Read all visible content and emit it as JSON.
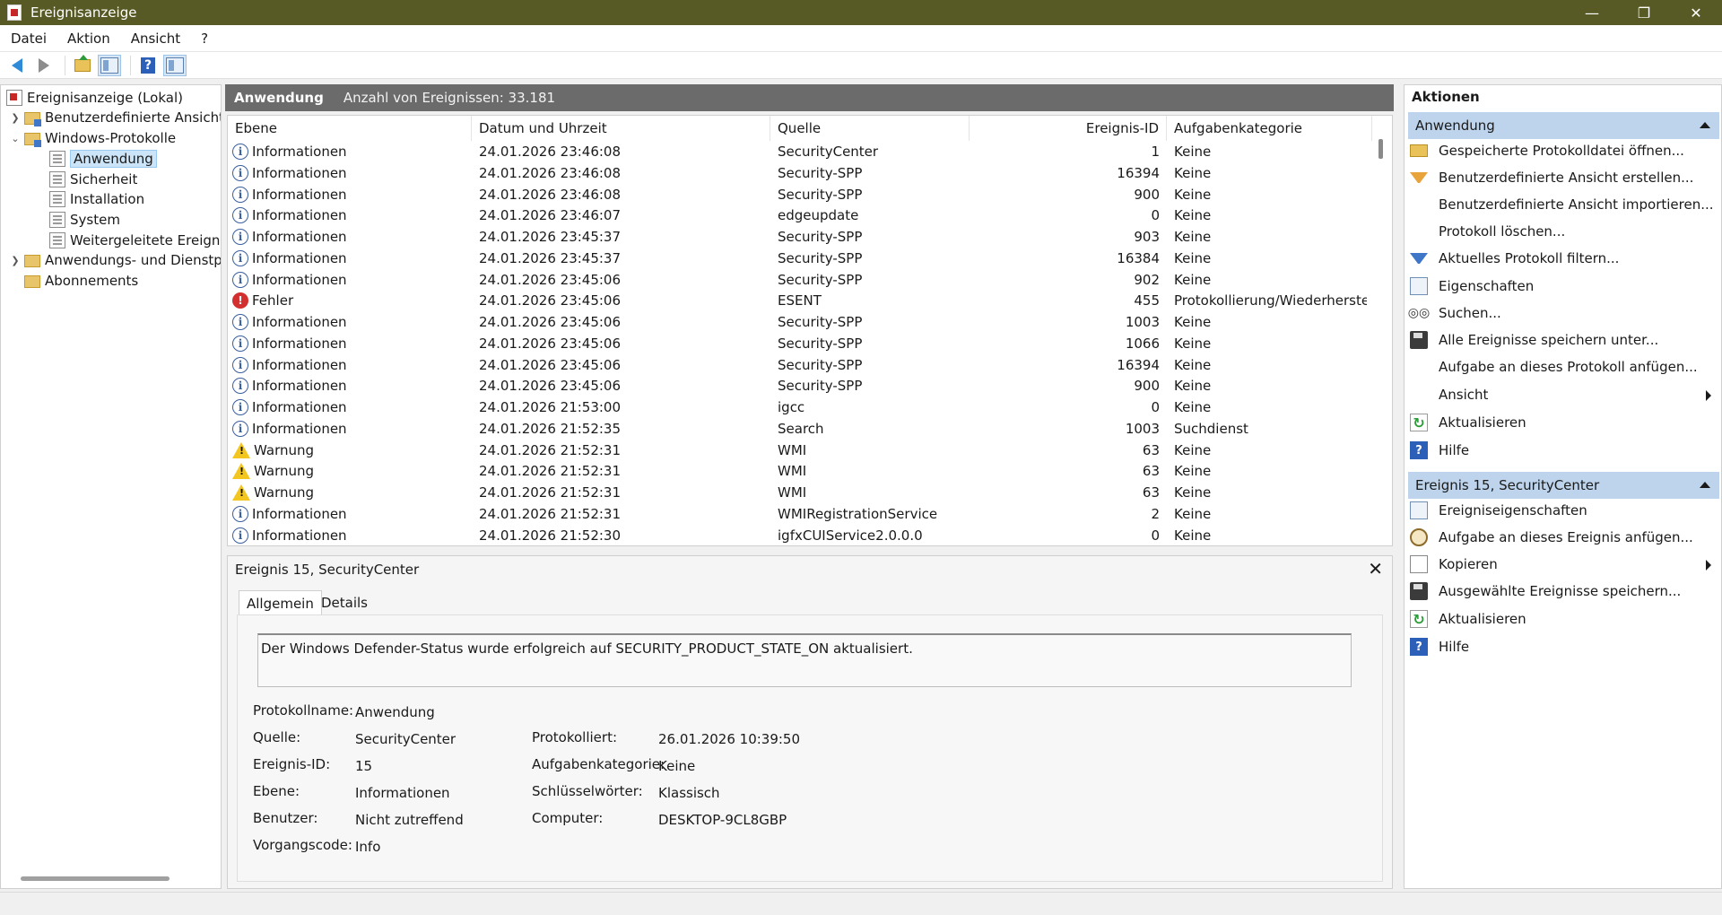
{
  "window": {
    "title": "Ereignisanzeige",
    "controls": [
      "—",
      "❐",
      "✕"
    ]
  },
  "menu": [
    "Datei",
    "Aktion",
    "Ansicht",
    "?"
  ],
  "tree": [
    {
      "label": "Ereignisanzeige (Lokal)",
      "level": 0,
      "expander": "",
      "icon": "event-viewer-icon",
      "selected": false
    },
    {
      "label": "Benutzerdefinierte Ansichten",
      "level": 1,
      "expander": ">",
      "icon": "custom-views-folder-icon",
      "selected": false
    },
    {
      "label": "Windows-Protokolle",
      "level": 1,
      "expander": "v",
      "icon": "windows-logs-folder-icon",
      "selected": false
    },
    {
      "label": "Anwendung",
      "level": 2,
      "expander": "",
      "icon": "log-icon",
      "selected": true
    },
    {
      "label": "Sicherheit",
      "level": 2,
      "expander": "",
      "icon": "log-icon",
      "selected": false
    },
    {
      "label": "Installation",
      "level": 2,
      "expander": "",
      "icon": "log-icon",
      "selected": false
    },
    {
      "label": "System",
      "level": 2,
      "expander": "",
      "icon": "log-icon",
      "selected": false
    },
    {
      "label": "Weitergeleitete Ereignisse",
      "level": 2,
      "expander": "",
      "icon": "log-icon",
      "selected": false
    },
    {
      "label": "Anwendungs- und Dienstprotokolle",
      "level": 1,
      "expander": ">",
      "icon": "folder-icon",
      "selected": false
    },
    {
      "label": "Abonnements",
      "level": 1,
      "expander": "",
      "icon": "subscriptions-icon",
      "selected": false
    }
  ],
  "center": {
    "log_name": "Anwendung",
    "event_count": "Anzahl von Ereignissen: 33.181"
  },
  "table": {
    "columns": [
      "Ebene",
      "Datum und Uhrzeit",
      "Quelle",
      "Ereignis-ID",
      "Aufgabenkategorie"
    ],
    "rows": [
      {
        "level": "Informationen",
        "type": "info",
        "datetime": "24.01.2026 23:46:08",
        "source": "SecurityCenter",
        "id": "1",
        "category": "Keine"
      },
      {
        "level": "Informationen",
        "type": "info",
        "datetime": "24.01.2026 23:46:08",
        "source": "Security-SPP",
        "id": "16394",
        "category": "Keine"
      },
      {
        "level": "Informationen",
        "type": "info",
        "datetime": "24.01.2026 23:46:08",
        "source": "Security-SPP",
        "id": "900",
        "category": "Keine"
      },
      {
        "level": "Informationen",
        "type": "info",
        "datetime": "24.01.2026 23:46:07",
        "source": "edgeupdate",
        "id": "0",
        "category": "Keine"
      },
      {
        "level": "Informationen",
        "type": "info",
        "datetime": "24.01.2026 23:45:37",
        "source": "Security-SPP",
        "id": "903",
        "category": "Keine"
      },
      {
        "level": "Informationen",
        "type": "info",
        "datetime": "24.01.2026 23:45:37",
        "source": "Security-SPP",
        "id": "16384",
        "category": "Keine"
      },
      {
        "level": "Informationen",
        "type": "info",
        "datetime": "24.01.2026 23:45:06",
        "source": "Security-SPP",
        "id": "902",
        "category": "Keine"
      },
      {
        "level": "Fehler",
        "type": "error",
        "datetime": "24.01.2026 23:45:06",
        "source": "ESENT",
        "id": "455",
        "category": "Protokollierung/Wiederherstell..."
      },
      {
        "level": "Informationen",
        "type": "info",
        "datetime": "24.01.2026 23:45:06",
        "source": "Security-SPP",
        "id": "1003",
        "category": "Keine"
      },
      {
        "level": "Informationen",
        "type": "info",
        "datetime": "24.01.2026 23:45:06",
        "source": "Security-SPP",
        "id": "1066",
        "category": "Keine"
      },
      {
        "level": "Informationen",
        "type": "info",
        "datetime": "24.01.2026 23:45:06",
        "source": "Security-SPP",
        "id": "16394",
        "category": "Keine"
      },
      {
        "level": "Informationen",
        "type": "info",
        "datetime": "24.01.2026 23:45:06",
        "source": "Security-SPP",
        "id": "900",
        "category": "Keine"
      },
      {
        "level": "Informationen",
        "type": "info",
        "datetime": "24.01.2026 21:53:00",
        "source": "igcc",
        "id": "0",
        "category": "Keine"
      },
      {
        "level": "Informationen",
        "type": "info",
        "datetime": "24.01.2026 21:52:35",
        "source": "Search",
        "id": "1003",
        "category": "Suchdienst"
      },
      {
        "level": "Warnung",
        "type": "warn",
        "datetime": "24.01.2026 21:52:31",
        "source": "WMI",
        "id": "63",
        "category": "Keine"
      },
      {
        "level": "Warnung",
        "type": "warn",
        "datetime": "24.01.2026 21:52:31",
        "source": "WMI",
        "id": "63",
        "category": "Keine"
      },
      {
        "level": "Warnung",
        "type": "warn",
        "datetime": "24.01.2026 21:52:31",
        "source": "WMI",
        "id": "63",
        "category": "Keine"
      },
      {
        "level": "Informationen",
        "type": "info",
        "datetime": "24.01.2026 21:52:31",
        "source": "WMIRegistrationService",
        "id": "2",
        "category": "Keine"
      },
      {
        "level": "Informationen",
        "type": "info",
        "datetime": "24.01.2026 21:52:30",
        "source": "igfxCUIService2.0.0.0",
        "id": "0",
        "category": "Keine"
      }
    ]
  },
  "detail": {
    "title": "Ereignis 15, SecurityCenter",
    "close": "✕",
    "tabs": [
      "Allgemein",
      "Details"
    ],
    "description": "Der Windows Defender-Status wurde erfolgreich auf SECURITY_PRODUCT_STATE_ON aktualisiert.",
    "labels": {
      "log_name": "Protokollname:",
      "source": "Quelle:",
      "event_id": "Ereignis-ID:",
      "level": "Ebene:",
      "user": "Benutzer:",
      "opcode": "Vorgangscode:",
      "logged": "Protokolliert:",
      "task_category": "Aufgabenkategorie:",
      "keywords": "Schlüsselwörter:",
      "computer": "Computer:"
    },
    "values": {
      "log_name": "Anwendung",
      "source": "SecurityCenter",
      "event_id": "15",
      "level": "Informationen",
      "user": "Nicht zutreffend",
      "opcode": "Info",
      "logged": "26.01.2026 10:39:50",
      "task_category": "Keine",
      "keywords": "Klassisch",
      "computer": "DESKTOP-9CL8GBP"
    }
  },
  "actions": {
    "title": "Aktionen",
    "section1": {
      "title": "Anwendung",
      "items": [
        {
          "label": "Gespeicherte Protokolldatei öffnen...",
          "icon": "open-log-icon",
          "submenu": false
        },
        {
          "label": "Benutzerdefinierte Ansicht erstellen...",
          "icon": "create-view-filter-icon",
          "submenu": false
        },
        {
          "label": "Benutzerdefinierte Ansicht importieren...",
          "icon": "",
          "submenu": false
        },
        {
          "label": "Protokoll löschen...",
          "icon": "",
          "submenu": false
        },
        {
          "label": "Aktuelles Protokoll filtern...",
          "icon": "filter-icon",
          "submenu": false
        },
        {
          "label": "Eigenschaften",
          "icon": "properties-icon",
          "submenu": false
        },
        {
          "label": "Suchen...",
          "icon": "binoculars-icon",
          "submenu": false
        },
        {
          "label": "Alle Ereignisse speichern unter...",
          "icon": "save-icon",
          "submenu": false
        },
        {
          "label": "Aufgabe an dieses Protokoll anfügen...",
          "icon": "",
          "submenu": false
        },
        {
          "label": "Ansicht",
          "icon": "",
          "submenu": true
        },
        {
          "label": "Aktualisieren",
          "icon": "refresh-icon",
          "submenu": false
        },
        {
          "label": "Hilfe",
          "icon": "help-icon",
          "submenu": false
        }
      ]
    },
    "section2": {
      "title": "Ereignis 15, SecurityCenter",
      "items": [
        {
          "label": "Ereigniseigenschaften",
          "icon": "event-properties-icon",
          "submenu": false
        },
        {
          "label": "Aufgabe an dieses Ereignis anfügen...",
          "icon": "attach-task-icon",
          "submenu": false
        },
        {
          "label": "Kopieren",
          "icon": "copy-icon",
          "submenu": true
        },
        {
          "label": "Ausgewählte Ereignisse speichern...",
          "icon": "save-icon",
          "submenu": false
        },
        {
          "label": "Aktualisieren",
          "icon": "refresh-icon",
          "submenu": false
        },
        {
          "label": "Hilfe",
          "icon": "help-icon",
          "submenu": false
        }
      ]
    }
  }
}
